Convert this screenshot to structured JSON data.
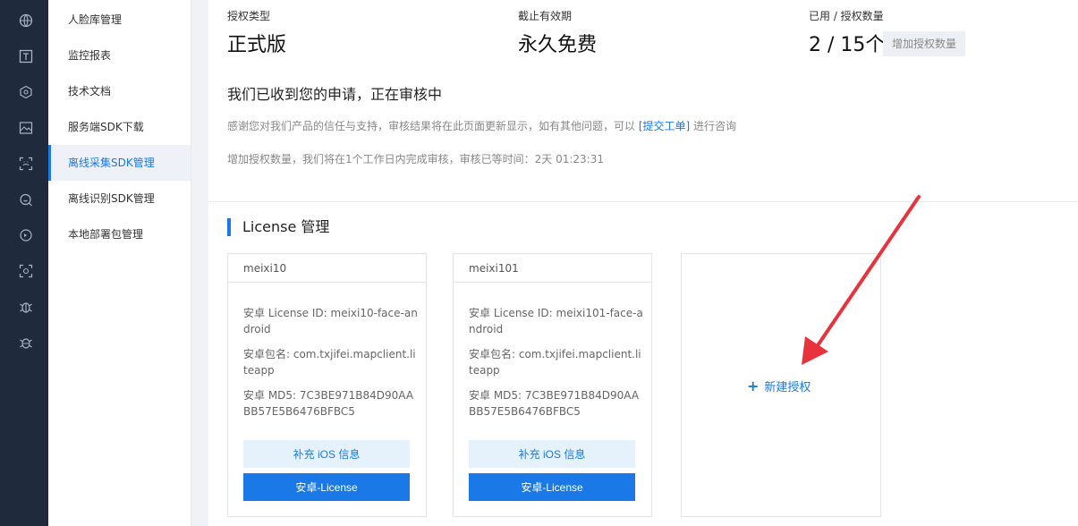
{
  "rail_icons": [
    "globe-icon",
    "text-icon",
    "cube-icon",
    "image-icon",
    "face-scan-icon",
    "face-search-icon",
    "refresh-face-icon",
    "scan-frame-icon",
    "bug-icon",
    "bug-alt-icon"
  ],
  "menu": {
    "items": [
      {
        "label": "人脸库管理"
      },
      {
        "label": "监控报表"
      },
      {
        "label": "技术文档"
      },
      {
        "label": "服务端SDK下载"
      },
      {
        "label": "离线采集SDK管理"
      },
      {
        "label": "离线识别SDK管理"
      },
      {
        "label": "本地部署包管理"
      }
    ],
    "active_index": 4
  },
  "stats": {
    "license_type_label": "授权类型",
    "license_type_value": "正式版",
    "expiry_label": "截止有效期",
    "expiry_value": "永久免费",
    "quota_label": "已用 / 授权数量",
    "quota_value": "2 / 15个",
    "quota_button": "增加授权数量"
  },
  "notice": {
    "title": "我们已收到您的申请，正在审核中",
    "text_before": "感谢您对我们产品的信任与支持，审核结果将在此页面更新显示，如有其他问题，可以 ",
    "link": "[提交工单]",
    "text_after": " 进行咨询",
    "wait": "增加授权数量，我们将在1个工作日内完成审核，审核已等时间：2天 01:23:31"
  },
  "license_section": {
    "title": "License 管理",
    "new_label": "新建授权"
  },
  "cards": [
    {
      "name": "meixi10",
      "license_id": "安卓 License ID: meixi10-face-android",
      "package": "安卓包名: com.txjifei.mapclient.liteapp",
      "md5": "安卓 MD5: 7C3BE971B84D90AABB57E5B6476BFBC5",
      "ios_button": "补充 iOS 信息",
      "android_button": "安卓-License"
    },
    {
      "name": "meixi101",
      "license_id": "安卓 License ID: meixi101-face-android",
      "package": "安卓包名: com.txjifei.mapclient.liteapp",
      "md5": "安卓 MD5: 7C3BE971B84D90AABB57E5B6476BFBC5",
      "ios_button": "补充 iOS 信息",
      "android_button": "安卓-License"
    }
  ],
  "colors": {
    "accent": "#1a79e6",
    "annotation_arrow": "#e8333c",
    "rail_bg": "#1f2a3d"
  }
}
